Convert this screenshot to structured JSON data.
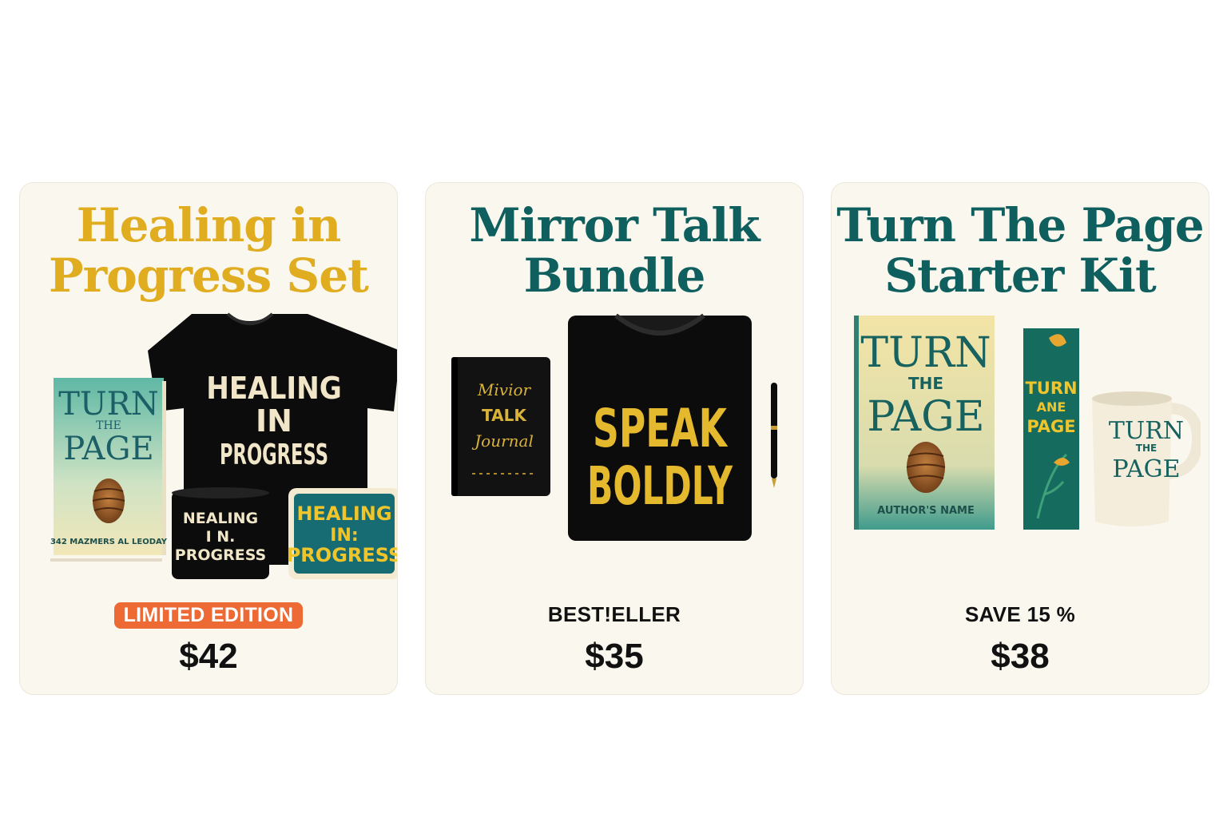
{
  "products": [
    {
      "title_line1": "Healing in",
      "title_line2": "Progress Set",
      "badge": "LIMITED EDITION",
      "price": "$42",
      "items": {
        "book_turn": "TURN",
        "book_the": "THE",
        "book_page": "PAGE",
        "book_author": "342 MAZMERS AL LEODAY",
        "tshirt_line1": "HEALING",
        "tshirt_line2": "IN",
        "tshirt_line3": "PROGRESS",
        "mug_line1": "NEALING",
        "mug_line2": "I N.",
        "mug_line3": "PROGRESS",
        "coaster_line1": "HEALING",
        "coaster_line2": "IN:",
        "coaster_line3": "PROGRESS"
      }
    },
    {
      "title_line1": "Mirror Talk",
      "title_line2": "Bundle",
      "badge": "BEST!ELLER",
      "price": "$35",
      "items": {
        "journal_line1": "Mivior",
        "journal_line2": "TALK",
        "journal_line3": "Journal",
        "tshirt_line1": "SPEAK",
        "tshirt_line2": "BOLDLY"
      }
    },
    {
      "title_line1": "Turn The Page",
      "title_line2": "Starter Kit",
      "badge": "SAVE 15 %",
      "price": "$38",
      "items": {
        "book_turn": "TURN",
        "book_the": "THE",
        "book_page": "PAGE",
        "book_author": "AUTHOR'S NAME",
        "bookmark_line1": "TURN",
        "bookmark_line2": "ANE",
        "bookmark_line3": "PAGE",
        "mug_line1": "TURN",
        "mug_line2": "THE",
        "mug_line3": "PAGE"
      }
    }
  ],
  "colors": {
    "card_bg": "#faf7ef",
    "gold": "#e0ac20",
    "teal": "#0f5f5e",
    "badge_orange": "#ee6a35",
    "shirt_black": "#0c0c0c"
  }
}
